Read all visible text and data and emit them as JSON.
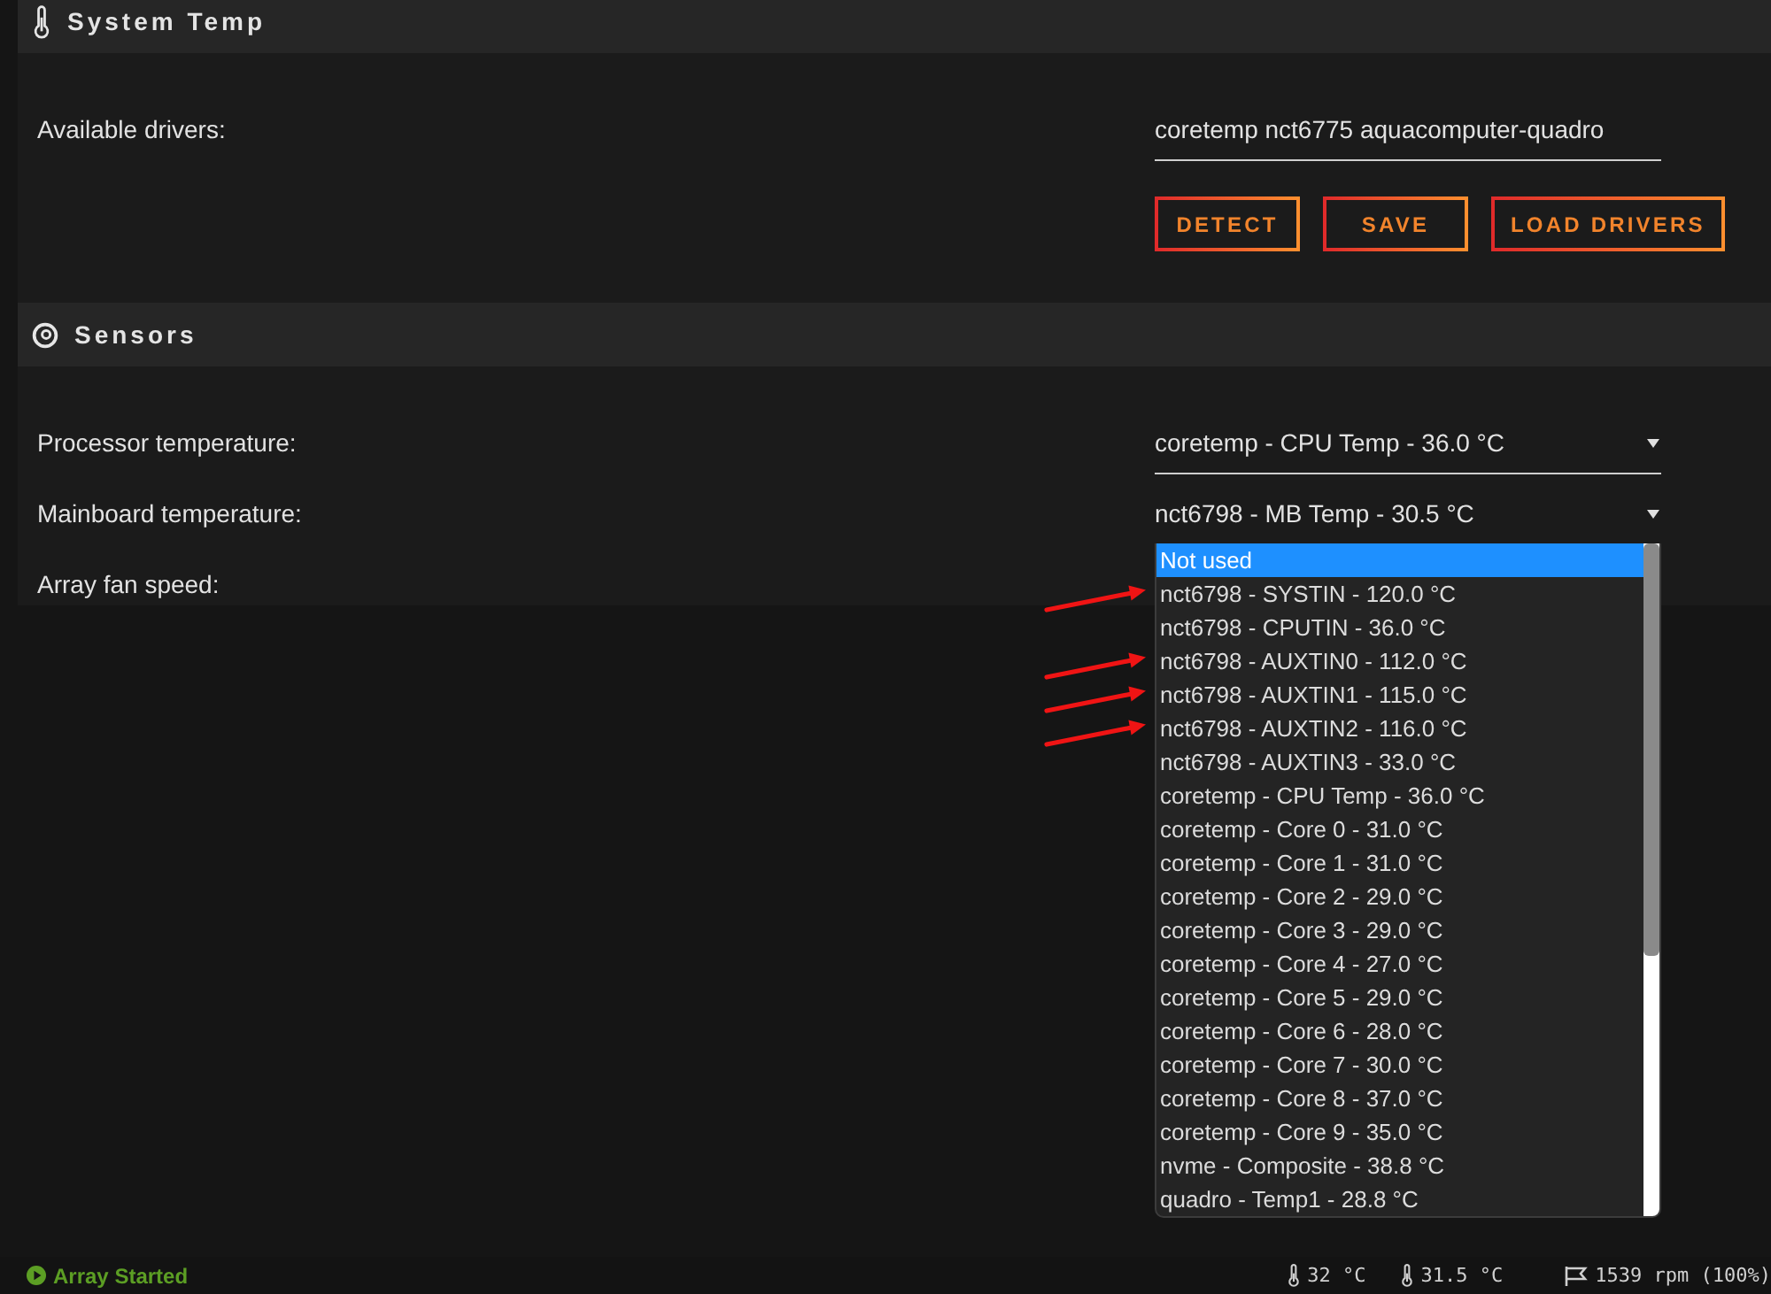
{
  "system_temp": {
    "title": "System Temp",
    "drivers": {
      "label": "Available drivers:",
      "value": "coretemp nct6775 aquacomputer-quadro"
    },
    "buttons": [
      "DETECT",
      "SAVE",
      "LOAD DRIVERS"
    ]
  },
  "sensors": {
    "title": "Sensors",
    "fields": [
      {
        "label": "Processor temperature:",
        "value": "coretemp - CPU Temp - 36.0 °C",
        "expanded": false
      },
      {
        "label": "Mainboard temperature:",
        "value": "nct6798 - MB Temp - 30.5 °C",
        "expanded": false
      },
      {
        "label": "Array fan speed:",
        "expanded": true,
        "options": [
          {
            "label": "Not used",
            "selected": true,
            "flagged": false
          },
          {
            "label": "nct6798 - SYSTIN - 120.0 °C",
            "selected": false,
            "flagged": true
          },
          {
            "label": "nct6798 - CPUTIN - 36.0 °C",
            "selected": false,
            "flagged": false
          },
          {
            "label": "nct6798 - AUXTIN0 - 112.0 °C",
            "selected": false,
            "flagged": true
          },
          {
            "label": "nct6798 - AUXTIN1 - 115.0 °C",
            "selected": false,
            "flagged": true
          },
          {
            "label": "nct6798 - AUXTIN2 - 116.0 °C",
            "selected": false,
            "flagged": true
          },
          {
            "label": "nct6798 - AUXTIN3 - 33.0 °C",
            "selected": false,
            "flagged": false
          },
          {
            "label": "coretemp - CPU Temp - 36.0 °C",
            "selected": false,
            "flagged": false
          },
          {
            "label": "coretemp - Core 0 - 31.0 °C",
            "selected": false,
            "flagged": false
          },
          {
            "label": "coretemp - Core 1 - 31.0 °C",
            "selected": false,
            "flagged": false
          },
          {
            "label": "coretemp - Core 2 - 29.0 °C",
            "selected": false,
            "flagged": false
          },
          {
            "label": "coretemp - Core 3 - 29.0 °C",
            "selected": false,
            "flagged": false
          },
          {
            "label": "coretemp - Core 4 - 27.0 °C",
            "selected": false,
            "flagged": false
          },
          {
            "label": "coretemp - Core 5 - 29.0 °C",
            "selected": false,
            "flagged": false
          },
          {
            "label": "coretemp - Core 6 - 28.0 °C",
            "selected": false,
            "flagged": false
          },
          {
            "label": "coretemp - Core 7 - 30.0 °C",
            "selected": false,
            "flagged": false
          },
          {
            "label": "coretemp - Core 8 - 37.0 °C",
            "selected": false,
            "flagged": false
          },
          {
            "label": "coretemp - Core 9 - 35.0 °C",
            "selected": false,
            "flagged": false
          },
          {
            "label": "nvme - Composite - 38.8 °C",
            "selected": false,
            "flagged": false
          },
          {
            "label": "quadro - Temp1 - 28.8 °C",
            "selected": false,
            "flagged": false
          }
        ]
      }
    ]
  },
  "status_bar": {
    "array_status": "Array Started",
    "running": true,
    "readings": [
      {
        "kind": "temperature",
        "value": "32 °C"
      },
      {
        "kind": "temperature",
        "value": "31.5 °C"
      },
      {
        "kind": "fan",
        "value": "1539 rpm (100%)"
      }
    ]
  }
}
